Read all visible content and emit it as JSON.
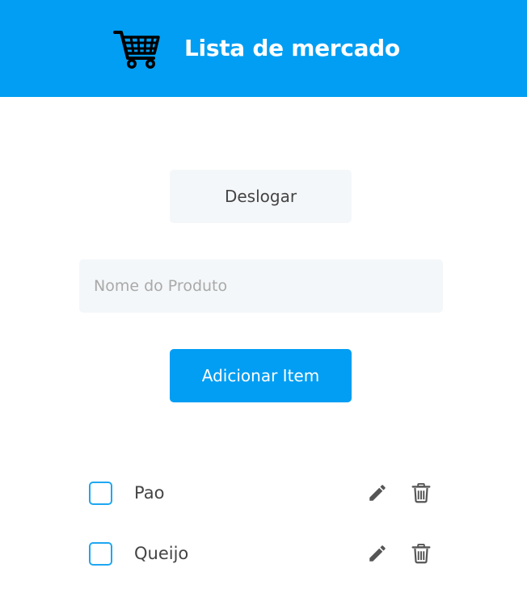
{
  "header": {
    "title": "Lista de mercado",
    "icon": "shopping-cart-icon",
    "background_color": "#019ef3"
  },
  "actions": {
    "logout_label": "Deslogar",
    "add_label": "Adicionar Item",
    "accent_color": "#019ef3"
  },
  "product_input": {
    "placeholder": "Nome do Produto",
    "value": ""
  },
  "items": [
    {
      "name": "Pao",
      "checked": false
    },
    {
      "name": "Queijo",
      "checked": false
    }
  ],
  "item_icons": {
    "edit": "pencil-icon",
    "delete": "trash-icon"
  }
}
